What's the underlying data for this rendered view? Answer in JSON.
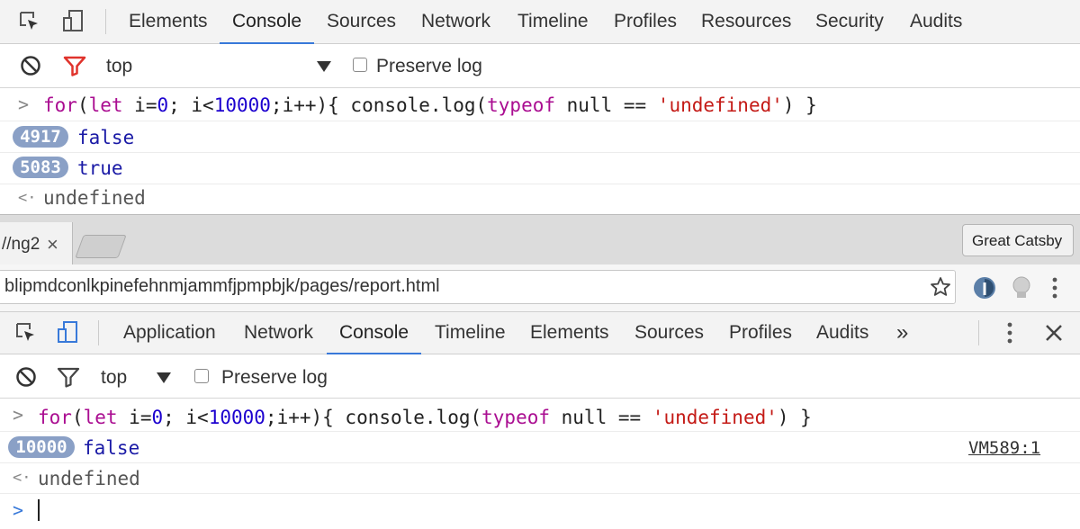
{
  "devtools_top": {
    "tabs": [
      "Elements",
      "Console",
      "Sources",
      "Network",
      "Timeline",
      "Profiles",
      "Resources",
      "Security",
      "Audits"
    ],
    "active_tab": "Console",
    "filter": {
      "context": "top",
      "preserve_log": "Preserve log"
    },
    "input": {
      "kw1": "for",
      "paren": "(",
      "kw2": "let",
      "mid1": " i=",
      "n0": "0",
      "mid2": "; i<",
      "n1": "10000",
      "mid3": ";i++){ console.log(",
      "kw3": "typeof",
      "mid4": " null == ",
      "s": "'undefined'",
      "end": ") }"
    },
    "logs": [
      {
        "count": "4917",
        "value": "false"
      },
      {
        "count": "5083",
        "value": "true"
      }
    ],
    "result": "undefined"
  },
  "browser": {
    "tab_title": "//ng2",
    "tab_close": "×",
    "profile_button": "Great Catsby",
    "url": "blipmdconlkpinefehnmjammfjpmpbjk/pages/report.html"
  },
  "devtools_bottom": {
    "tabs": [
      "Application",
      "Network",
      "Console",
      "Timeline",
      "Elements",
      "Sources",
      "Profiles",
      "Audits"
    ],
    "active_tab": "Console",
    "overflow": "»",
    "filter": {
      "context": "top",
      "preserve_log": "Preserve log"
    },
    "input": {
      "kw1": "for",
      "paren": "(",
      "kw2": "let",
      "mid1": " i=",
      "n0": "0",
      "mid2": "; i<",
      "n1": "10000",
      "mid3": ";i++){ console.log(",
      "kw3": "typeof",
      "mid4": " null == ",
      "s": "'undefined'",
      "end": ") }"
    },
    "logs": [
      {
        "count": "10000",
        "value": "false",
        "source": "VM589:1"
      }
    ],
    "result": "undefined"
  },
  "colors": {
    "accent": "#3879d9",
    "badge": "#8aa0c6",
    "keyword": "#aa0d91",
    "number": "#1c00cf",
    "string": "#c41a16",
    "filter_red": "#e0332c"
  }
}
